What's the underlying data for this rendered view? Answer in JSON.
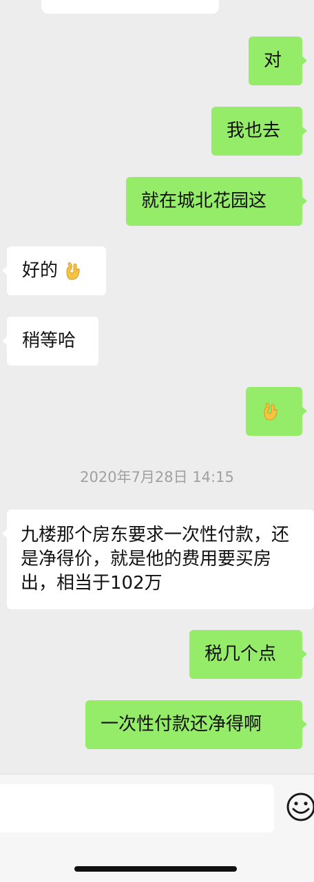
{
  "messages": [
    {
      "side": "out",
      "text": "对"
    },
    {
      "side": "out",
      "text": "我也去"
    },
    {
      "side": "out",
      "text": "就在城北花园这"
    },
    {
      "side": "in",
      "text": "好的",
      "emoji": "ok-hand-emoji"
    },
    {
      "side": "in",
      "text": "稍等哈"
    },
    {
      "side": "out",
      "text": "",
      "emoji": "ok-hand-emoji"
    },
    {
      "side": "in",
      "text": "九楼那个房东要求一次性付款，还是净得价，就是他的费用要买房出，相当于102万"
    },
    {
      "side": "out",
      "text": "税几个点"
    },
    {
      "side": "out",
      "text": "一次性付款还净得啊"
    }
  ],
  "timestamp": "2020年7月28日 14:15",
  "input": {
    "placeholder": "",
    "value": ""
  },
  "icons": {
    "emoji_button": "smiley-face-icon"
  },
  "colors": {
    "background": "#ededed",
    "outgoing_bubble": "#95ec69",
    "incoming_bubble": "#ffffff"
  }
}
